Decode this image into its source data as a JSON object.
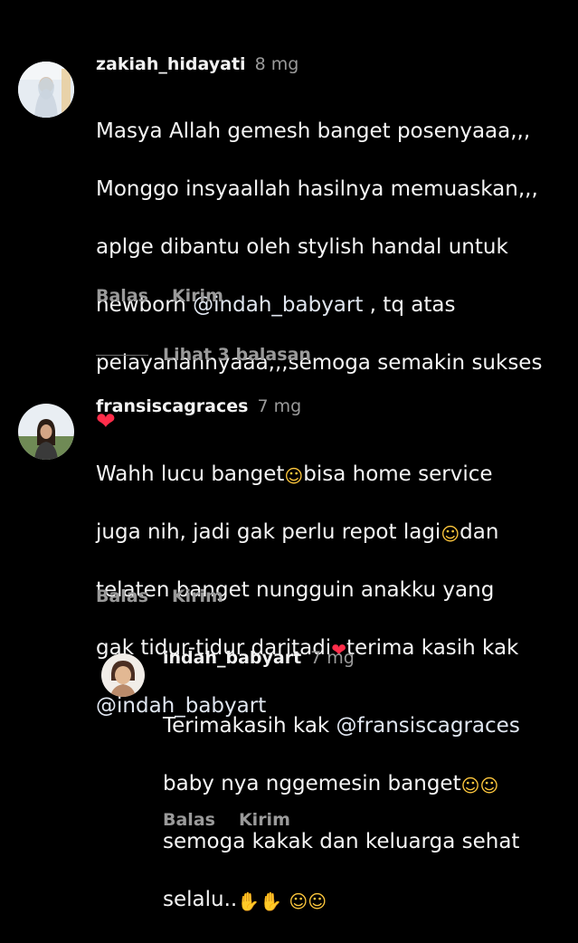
{
  "comments": [
    {
      "username": "zakiah_hidayati",
      "time": "8 mg",
      "line1": "Masya Allah gemesh banget posenyaaa,,,",
      "line2": "Monggo insyaallah hasilnya memuaskan,,,",
      "line3": "aplge dibantu oleh stylish handal untuk",
      "line4_pre": "newborn ",
      "line4_mention": "@indah_babyart",
      "line4_post": " , tq atas",
      "line5": "pelayanannyaaa,,,semoga semakin sukses",
      "emoji_heart": "❤",
      "reply_label": "Balas",
      "send_label": "Kirim"
    },
    {
      "username": "fransiscagraces",
      "time": "7 mg",
      "line1_pre": "Wahh lucu banget",
      "line1_post": "bisa home service",
      "line2_pre": "juga nih, jadi gak perlu repot lagi",
      "line2_post": "dan",
      "line3": "telaten banget nungguin anakku yang",
      "line4_pre": "gak tidur-tidur daritadi",
      "line4_post": "terima kasih kak",
      "line5_mention": "@indah_babyart",
      "emoji_heart_eyes": "☺",
      "emoji_smiling_hearts": "☺",
      "emoji_heart": "❤",
      "reply_label": "Balas",
      "send_label": "Kirim"
    }
  ],
  "view_replies": "Lihat 3 balasan",
  "reply": {
    "username": "indah_babyart",
    "time": "7 mg",
    "line1_pre": "Terimakasih kak ",
    "line1_mention": "@fransiscagraces",
    "line2": "baby nya nggemesin banget",
    "line3": "semoga kakak dan keluarga sehat",
    "line4": "selalu..",
    "emoji_pray": "✋",
    "emoji_hug": "☺",
    "emoji_heart_eyes": "☺",
    "reply_label": "Balas",
    "send_label": "Kirim"
  },
  "colors": {
    "background": "#000000",
    "text": "#f5f5f5",
    "secondary": "#9a9a9a",
    "heart": "#ff2d4a",
    "emoji_face": "#ffc83d"
  }
}
